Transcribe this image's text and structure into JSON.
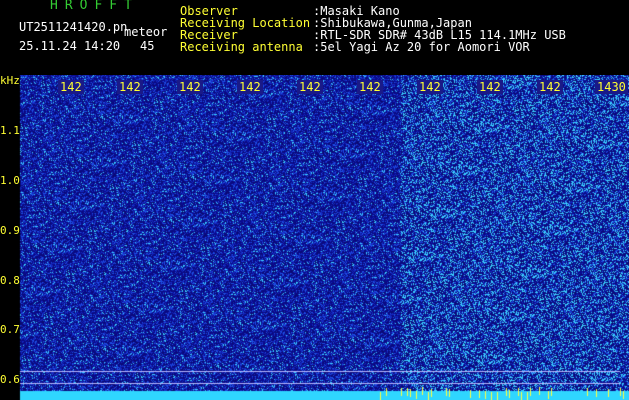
{
  "header": {
    "brand": "HROFFT",
    "filename": "UT2511241420.pn",
    "mode": "meteor",
    "datetime": "25.11.24 14:20",
    "count": "45",
    "rows": [
      {
        "label": "Observer",
        "value": ":Masaki Kano"
      },
      {
        "label": "Receiving Location",
        "value": ":Shibukawa,Gunma,Japan"
      },
      {
        "label": "Receiver",
        "value": ":RTL-SDR SDR# 43dB L15 114.1MHz USB"
      },
      {
        "label": "Receiving antenna",
        "value": ":5el Yagi Az 20 for Aomori VOR"
      }
    ]
  },
  "axis": {
    "unit": "kHz",
    "y_ticks": [
      "1.1",
      "1.0",
      "0.9",
      "0.8",
      "0.7",
      "0.6"
    ],
    "x_ticks": [
      "142",
      "142",
      "142",
      "142",
      "142",
      "142",
      "142",
      "142",
      "142",
      "1430"
    ]
  },
  "colors": {
    "background": "#000000",
    "waterfall_dark": "#0a0a5c",
    "waterfall_mid": "#1a3fd0",
    "waterfall_bright": "#4fd8ff",
    "label_yellow": "#ffff33",
    "label_green": "#33cc33"
  }
}
